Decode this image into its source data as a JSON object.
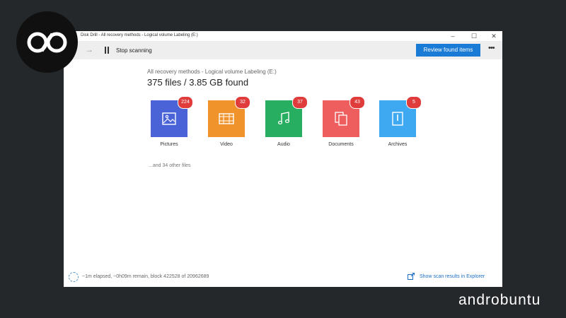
{
  "window": {
    "title": "Disk Drill - All recovery methods - Logical volume Labeling (E:)",
    "controls": {
      "minimize": "–",
      "maximize": "☐",
      "close": "✕"
    }
  },
  "toolbar": {
    "stop_label": "Stop scanning",
    "review_label": "Review found items",
    "more_label": "•••"
  },
  "scan": {
    "subtitle": "All recovery methods - Logical volume Labeling (E:)",
    "headline": "375 files / 3.85 GB found",
    "others": "...and 34 other files"
  },
  "categories": [
    {
      "label": "Pictures",
      "count": "224",
      "color": "#4a64d8",
      "icon": "image-icon"
    },
    {
      "label": "Video",
      "count": "32",
      "color": "#f0932b",
      "icon": "film-icon"
    },
    {
      "label": "Audio",
      "count": "37",
      "color": "#27ae60",
      "icon": "music-note-icon"
    },
    {
      "label": "Documents",
      "count": "43",
      "color": "#ee5e5e",
      "icon": "document-icon"
    },
    {
      "label": "Archives",
      "count": "5",
      "color": "#3ea8f0",
      "icon": "archive-icon"
    }
  ],
  "status": {
    "progress_text": "~1m elapsed, ~0h09m remain, block 422528 of 20962689",
    "explorer_link": "Show scan results in Explorer"
  },
  "watermark": {
    "brand": "androbuntu"
  },
  "colors": {
    "accent": "#1a7bd6",
    "badge": "#e03c3c",
    "background": "#25282b"
  }
}
